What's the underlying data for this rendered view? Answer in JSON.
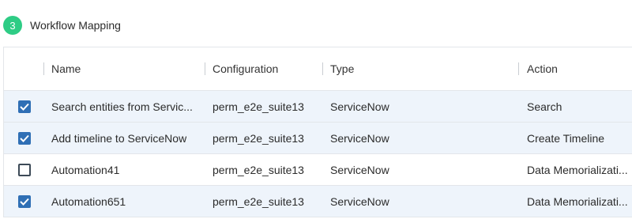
{
  "section": {
    "step": "3",
    "title": "Workflow Mapping"
  },
  "table": {
    "columns": {
      "name": "Name",
      "configuration": "Configuration",
      "type": "Type",
      "action": "Action"
    },
    "rows": [
      {
        "checked": true,
        "name": "Search entities from Servic...",
        "configuration": "perm_e2e_suite13",
        "type": "ServiceNow",
        "action": "Search"
      },
      {
        "checked": true,
        "name": "Add timeline to ServiceNow",
        "configuration": "perm_e2e_suite13",
        "type": "ServiceNow",
        "action": "Create Timeline"
      },
      {
        "checked": false,
        "name": "Automation41",
        "configuration": "perm_e2e_suite13",
        "type": "ServiceNow",
        "action": "Data Memorializati..."
      },
      {
        "checked": true,
        "name": "Automation651",
        "configuration": "perm_e2e_suite13",
        "type": "ServiceNow",
        "action": "Data Memorializati..."
      }
    ]
  },
  "colors": {
    "badge": "#2ecc85",
    "checkbox_checked": "#2f6fb5",
    "row_selected": "#eef4fb"
  },
  "icons": {
    "checked": "check-icon"
  }
}
